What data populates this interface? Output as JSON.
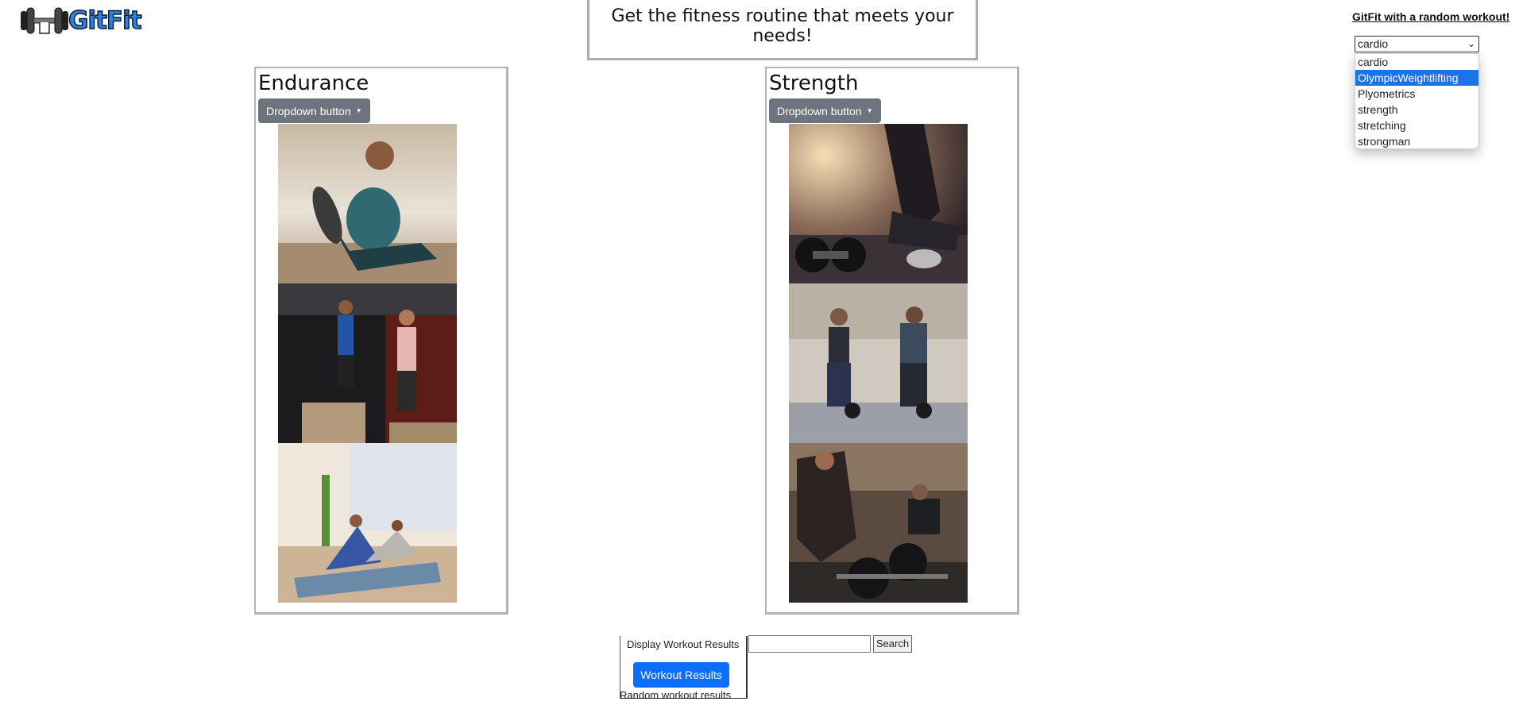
{
  "logo": {
    "text": "GitFit",
    "icon": "dumbbell-icon"
  },
  "header": {
    "title": "Get the fitness routine that meets your needs!"
  },
  "random_workout": {
    "link_label": "GitFit with a random workout!",
    "select_value": "cardio",
    "options": [
      "cardio",
      "OlympicWeightlifting",
      "Plyometrics",
      "strength",
      "stretching",
      "strongman"
    ],
    "highlighted_option": "OlympicWeightlifting"
  },
  "cards": [
    {
      "title": "Endurance",
      "button_label": "Dropdown button",
      "photos": [
        "person-stretching-photo",
        "box-jump-photo",
        "yoga-class-photo"
      ]
    },
    {
      "title": "Strength",
      "button_label": "Dropdown button",
      "photos": [
        "dumbbells-floor-photo",
        "kettlebell-pair-photo",
        "barbell-deadlift-photo"
      ]
    }
  ],
  "results": {
    "title": "Display Workout Results",
    "button_label": "Workout Results",
    "random_label": "Random workout results"
  },
  "search": {
    "input_value": "",
    "button_label": "Search"
  },
  "colors": {
    "primary": "#0d6efd",
    "secondary": "#6c757d",
    "select_highlight": "#1a73e8",
    "logo_blue": "#2a82e6"
  }
}
